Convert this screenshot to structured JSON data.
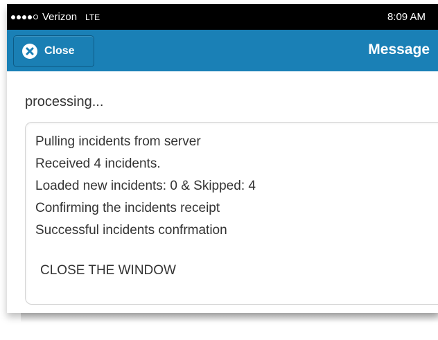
{
  "status_bar": {
    "carrier": "Verizon",
    "network": "LTE",
    "time": "8:09 AM",
    "signal_bars_filled": 4,
    "signal_bars_total": 5
  },
  "nav_bar": {
    "close_label": "Close",
    "title": "Message",
    "color": "#1a80b6"
  },
  "content": {
    "processing_text": "processing...",
    "log_lines": [
      "Pulling incidents from server",
      "Received 4 incidents.",
      "Loaded new incidents: 0 & Skipped: 4",
      "Confirming the incidents receipt",
      "Successful incidents confrmation"
    ],
    "close_window_label": "CLOSE THE WINDOW"
  }
}
